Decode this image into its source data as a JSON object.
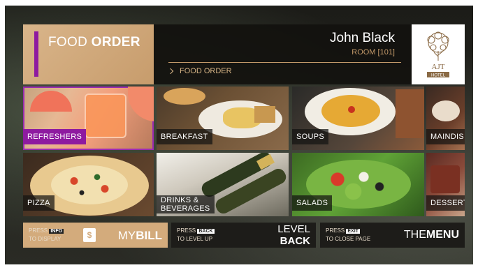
{
  "header": {
    "title_light": "FOOD ",
    "title_bold": "ORDER",
    "user_name": "John Black",
    "room": "ROOM [101]",
    "breadcrumb": "FOOD ORDER",
    "logo_text": "AJT",
    "logo_sub": "HOTEL"
  },
  "tiles": [
    {
      "label": "REFRESHERS",
      "selected": true
    },
    {
      "label": "BREAKFAST",
      "selected": false
    },
    {
      "label": "SOUPS",
      "selected": false
    },
    {
      "label": "MAINDIS",
      "selected": false
    },
    {
      "label": "PIZZA",
      "selected": false
    },
    {
      "label": "DRINKS &",
      "label2": "BEVERAGES",
      "selected": false
    },
    {
      "label": "SALADS",
      "selected": false
    },
    {
      "label": "DESSERT",
      "selected": false
    }
  ],
  "footer": {
    "bill": {
      "press": "PRESS",
      "key": "INFO",
      "to": "TO DISPLAY",
      "pre": "MY",
      "main": "BILL"
    },
    "back": {
      "press": "PRESS",
      "key": "BACK",
      "to": "TO LEVEL UP",
      "line1": "LEVEL",
      "line2": "BACK"
    },
    "exit": {
      "press": "PRESS",
      "key": "EXIT",
      "to": "TO CLOSE PAGE",
      "pre": "THE",
      "main": "MENU"
    }
  },
  "colors": {
    "accent": "#8e1aa0",
    "gold": "#c49a6a",
    "tan": "#d3ab7c"
  }
}
